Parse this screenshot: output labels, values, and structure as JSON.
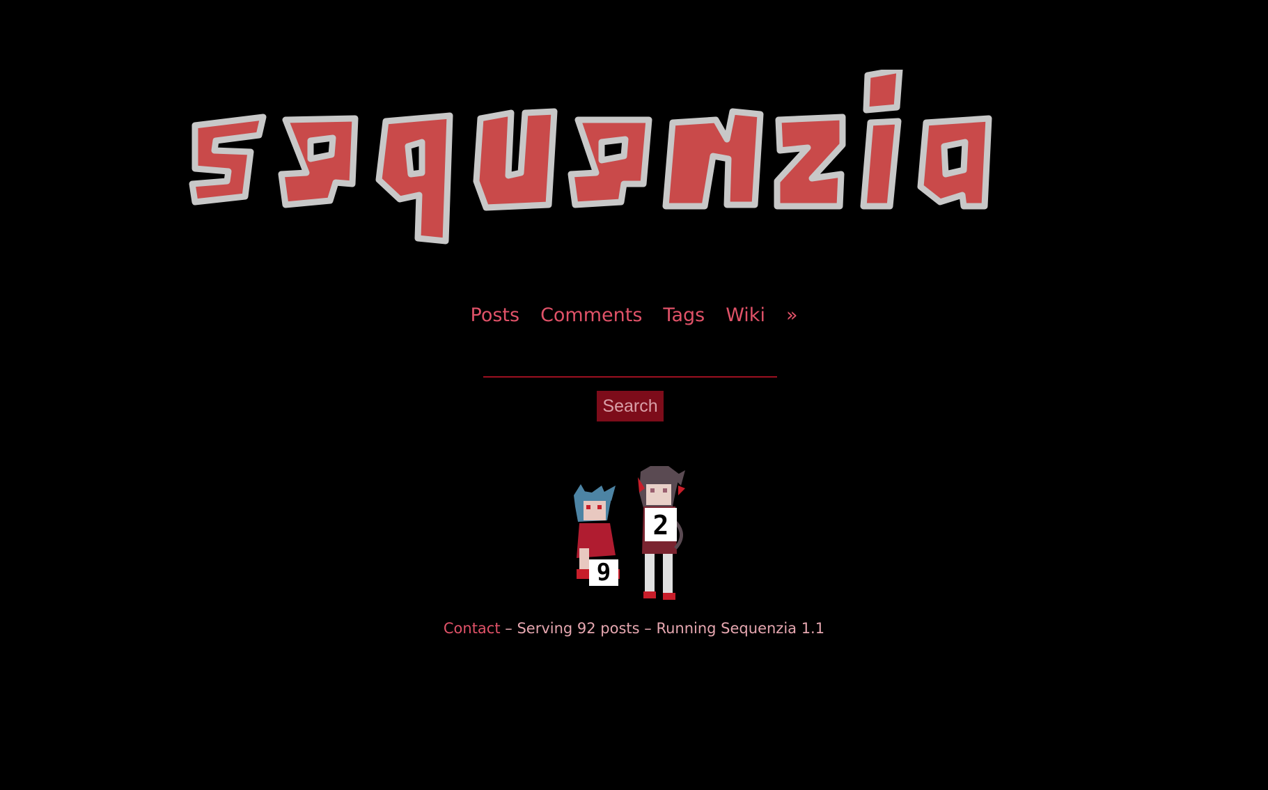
{
  "site": {
    "logo_text": "sequenzia"
  },
  "nav": {
    "items": [
      {
        "label": "Posts"
      },
      {
        "label": "Comments"
      },
      {
        "label": "Tags"
      },
      {
        "label": "Wiki"
      },
      {
        "label": "»"
      }
    ]
  },
  "search": {
    "value": "",
    "placeholder": "",
    "button_label": "Search"
  },
  "counter": {
    "digits": [
      "9",
      "2"
    ]
  },
  "footer": {
    "contact_label": "Contact",
    "sep1": " – ",
    "serving_text": "Serving 92 posts",
    "sep2": " – ",
    "running_text": "Running Sequenzia 1.1"
  },
  "colors": {
    "background": "#000000",
    "link": "#e05268",
    "logo_fill": "#c94a4a",
    "logo_stroke": "#c8c8c8",
    "button_bg": "#7d0c1a",
    "footer_text": "#e6a7b0"
  }
}
